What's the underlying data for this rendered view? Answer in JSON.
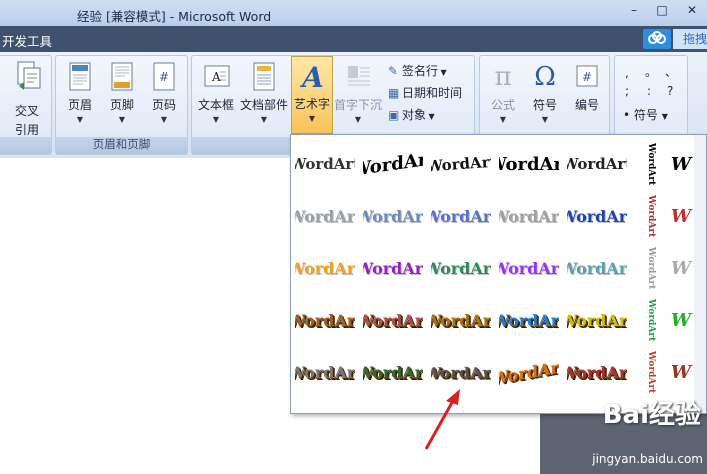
{
  "window": {
    "title": "经验 [兼容模式] - Microsoft Word",
    "controls": [
      "–",
      "□",
      "✕"
    ]
  },
  "tabstrip": {
    "tab_label": "开发工具",
    "right_button_label": "拖拽"
  },
  "ribbon": {
    "crossref": {
      "label_line1": "交叉",
      "label_line2": "引用"
    },
    "header_footer": {
      "group_label": "页眉和页脚",
      "buttons": [
        {
          "label": "页眉",
          "icon": "page-header-icon"
        },
        {
          "label": "页脚",
          "icon": "page-footer-icon"
        },
        {
          "label": "页码",
          "icon": "page-number-icon"
        }
      ]
    },
    "text": {
      "buttons": [
        {
          "label": "文本框",
          "icon": "textbox-icon"
        },
        {
          "label": "文档部件",
          "icon": "quickparts-icon"
        },
        {
          "label": "艺术字",
          "icon": "wordart-icon"
        },
        {
          "label": "首字下沉",
          "icon": "dropcap-icon"
        }
      ],
      "small_buttons": [
        {
          "label": "签名行",
          "icon": "signature-icon"
        },
        {
          "label": "日期和时间",
          "icon": "calendar-icon"
        },
        {
          "label": "对象",
          "icon": "object-icon"
        }
      ]
    },
    "symbols": {
      "buttons": [
        {
          "label": "公式",
          "icon": "pi-icon"
        },
        {
          "label": "符号",
          "icon": "omega-icon"
        },
        {
          "label": "编号",
          "icon": "number-icon"
        }
      ],
      "special": {
        "label": "符号",
        "glyphs": [
          ",",
          "。",
          "、",
          ";",
          ":",
          "?"
        ]
      }
    }
  },
  "wordart": {
    "sample_text": "WordArt",
    "rows": [
      [
        "#333333",
        "#000000",
        "#111111",
        "#000000",
        "#222222",
        "#000000",
        "#000000"
      ],
      [
        "#9aa0a8",
        "#6b8cc0",
        "#5a6fd0",
        "#a0a0a0",
        "#1c44b8",
        "#b03030",
        "#c03030"
      ],
      [
        "#f2a020",
        "#9b1fc9",
        "#2e8b57",
        "#9b30ff",
        "#5aa0b0",
        "#999999",
        "#aaaaaa"
      ],
      [
        "#a0602a",
        "#b05050",
        "#b07010",
        "#1f7fd6",
        "#d4c000",
        "#20a040",
        "#20b020"
      ],
      [
        "#777777",
        "#2f6a2f",
        "#555555",
        "#e0700c",
        "#b03030",
        "#c04020",
        "#a03020"
      ]
    ]
  },
  "watermark": {
    "text": "Bai经验",
    "subtext": "jingyan.baidu.com"
  }
}
